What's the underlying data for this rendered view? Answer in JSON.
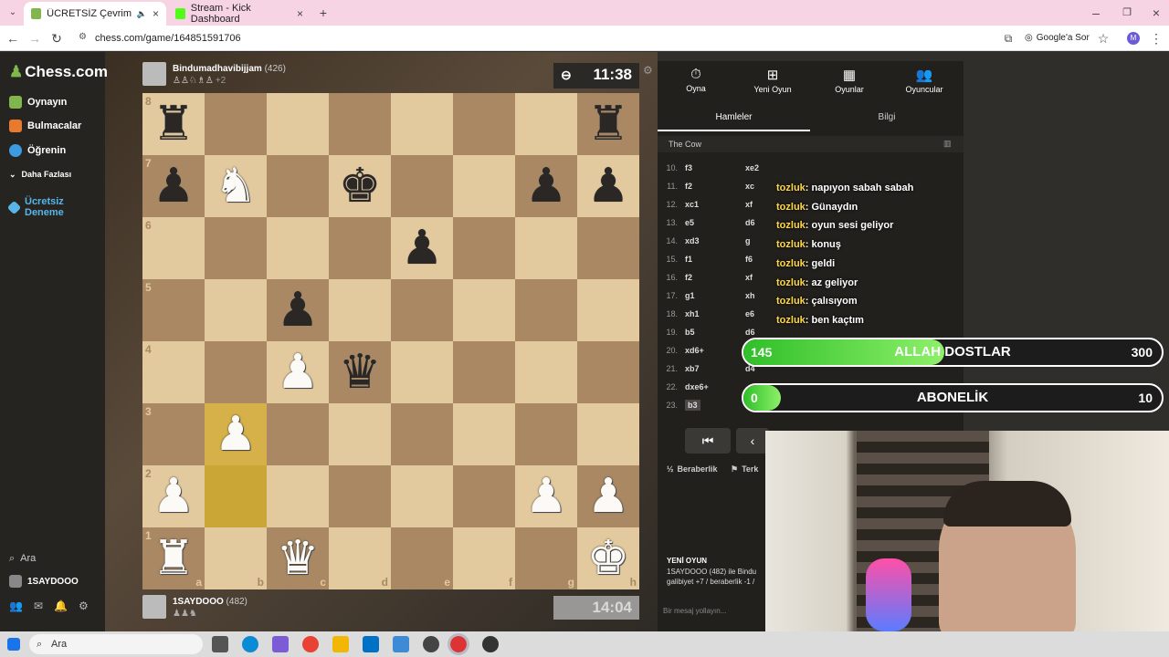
{
  "browser": {
    "tabs": [
      {
        "title": "ÜCRETSİZ Çevrimiçi Satranç",
        "active": true
      },
      {
        "title": "Stream - Kick Dashboard",
        "active": false
      }
    ],
    "url": "chess.com/game/164851591706",
    "google_lens": "Google'a Sor",
    "profile_initial": "M"
  },
  "sidebar": {
    "logo": "Chess.com",
    "items": [
      {
        "label": "Oynayın",
        "icon": "play-icon"
      },
      {
        "label": "Bulmacalar",
        "icon": "puzzle-icon"
      },
      {
        "label": "Öğrenin",
        "icon": "learn-icon"
      },
      {
        "label": "Daha Fazlası",
        "icon": "chevron-down-icon"
      },
      {
        "label": "Ücretsiz Deneme",
        "icon": "diamond-icon"
      }
    ],
    "search": "Ara",
    "username": "1SAYDOOO"
  },
  "game": {
    "top_player": {
      "name": "Bindumadhavibijjam",
      "rating": "(426)",
      "captured_extra": "+2",
      "clock": "11:38"
    },
    "bottom_player": {
      "name": "1SAYDOOO",
      "rating": "(482)",
      "clock": "14:04"
    },
    "board_fen_rows": [
      "r______r",
      "pN_k__pp",
      "____p___",
      "__p_____",
      "__Pq____",
      "_P______",
      "P_____PP",
      "R_Q____K"
    ],
    "highlighted": [
      "b3",
      "b2"
    ],
    "ranks": [
      "8",
      "7",
      "6",
      "5",
      "4",
      "3",
      "2",
      "1"
    ],
    "files": [
      "a",
      "b",
      "c",
      "d",
      "e",
      "f",
      "g",
      "h"
    ]
  },
  "panel": {
    "tabs": [
      {
        "label": "Oyna",
        "icon": "clock-icon"
      },
      {
        "label": "Yeni Oyun",
        "icon": "plus-icon"
      },
      {
        "label": "Oyunlar",
        "icon": "board-icon"
      },
      {
        "label": "Oyuncular",
        "icon": "players-icon"
      }
    ],
    "subtabs": [
      "Hamleler",
      "Bilgi"
    ],
    "opening": "The Cow",
    "moves": [
      {
        "n": "10.",
        "w": "f3",
        "b": "xe2"
      },
      {
        "n": "11.",
        "w": "f2",
        "b": "xc"
      },
      {
        "n": "12.",
        "w": "xc1",
        "b": "xf"
      },
      {
        "n": "13.",
        "w": "e5",
        "b": "d6"
      },
      {
        "n": "14.",
        "w": "xd3",
        "b": "g"
      },
      {
        "n": "15.",
        "w": "f1",
        "b": "f6"
      },
      {
        "n": "16.",
        "w": "f2",
        "b": "xf"
      },
      {
        "n": "17.",
        "w": "g1",
        "b": "xh"
      },
      {
        "n": "18.",
        "w": "xh1",
        "b": "e6"
      },
      {
        "n": "19.",
        "w": "b5",
        "b": "d6"
      },
      {
        "n": "20.",
        "w": "xd6+",
        "b": "c"
      },
      {
        "n": "21.",
        "w": "xb7",
        "b": "d4"
      },
      {
        "n": "22.",
        "w": "dxe6+",
        "b": ""
      },
      {
        "n": "23.",
        "w": "b3",
        "b": ""
      }
    ],
    "draw_label": "Beraberlik",
    "resign_label": "Terk",
    "new_game_title": "YENİ OYUN",
    "new_game_line1": "1SAYDOOO (482) ile Bindu",
    "new_game_line2": "galibiyet +7 / beraberlik -1 /",
    "chat_placeholder": "Bir mesaj yollayın..."
  },
  "stream_chat": [
    {
      "user": "tozluk",
      "msg": ": napıyon sabah sabah"
    },
    {
      "user": "tozluk",
      "msg": ": Günaydın"
    },
    {
      "user": "tozluk",
      "msg": ": oyun sesi geliyor"
    },
    {
      "user": "tozluk",
      "msg": ": konuş"
    },
    {
      "user": "tozluk",
      "msg": ": geldi"
    },
    {
      "user": "tozluk",
      "msg": ": az geliyor"
    },
    {
      "user": "tozluk",
      "msg": ": çalısıyom"
    },
    {
      "user": "tozluk",
      "msg": ": ben kaçtım"
    }
  ],
  "goals": [
    {
      "title": "ALLAH DOSTLAR",
      "current": "145",
      "target": "300",
      "progress": 0.48
    },
    {
      "title": "ABONELİK",
      "current": "0",
      "target": "10",
      "progress": 0.09
    }
  ],
  "taskbar": {
    "search": "Ara"
  }
}
